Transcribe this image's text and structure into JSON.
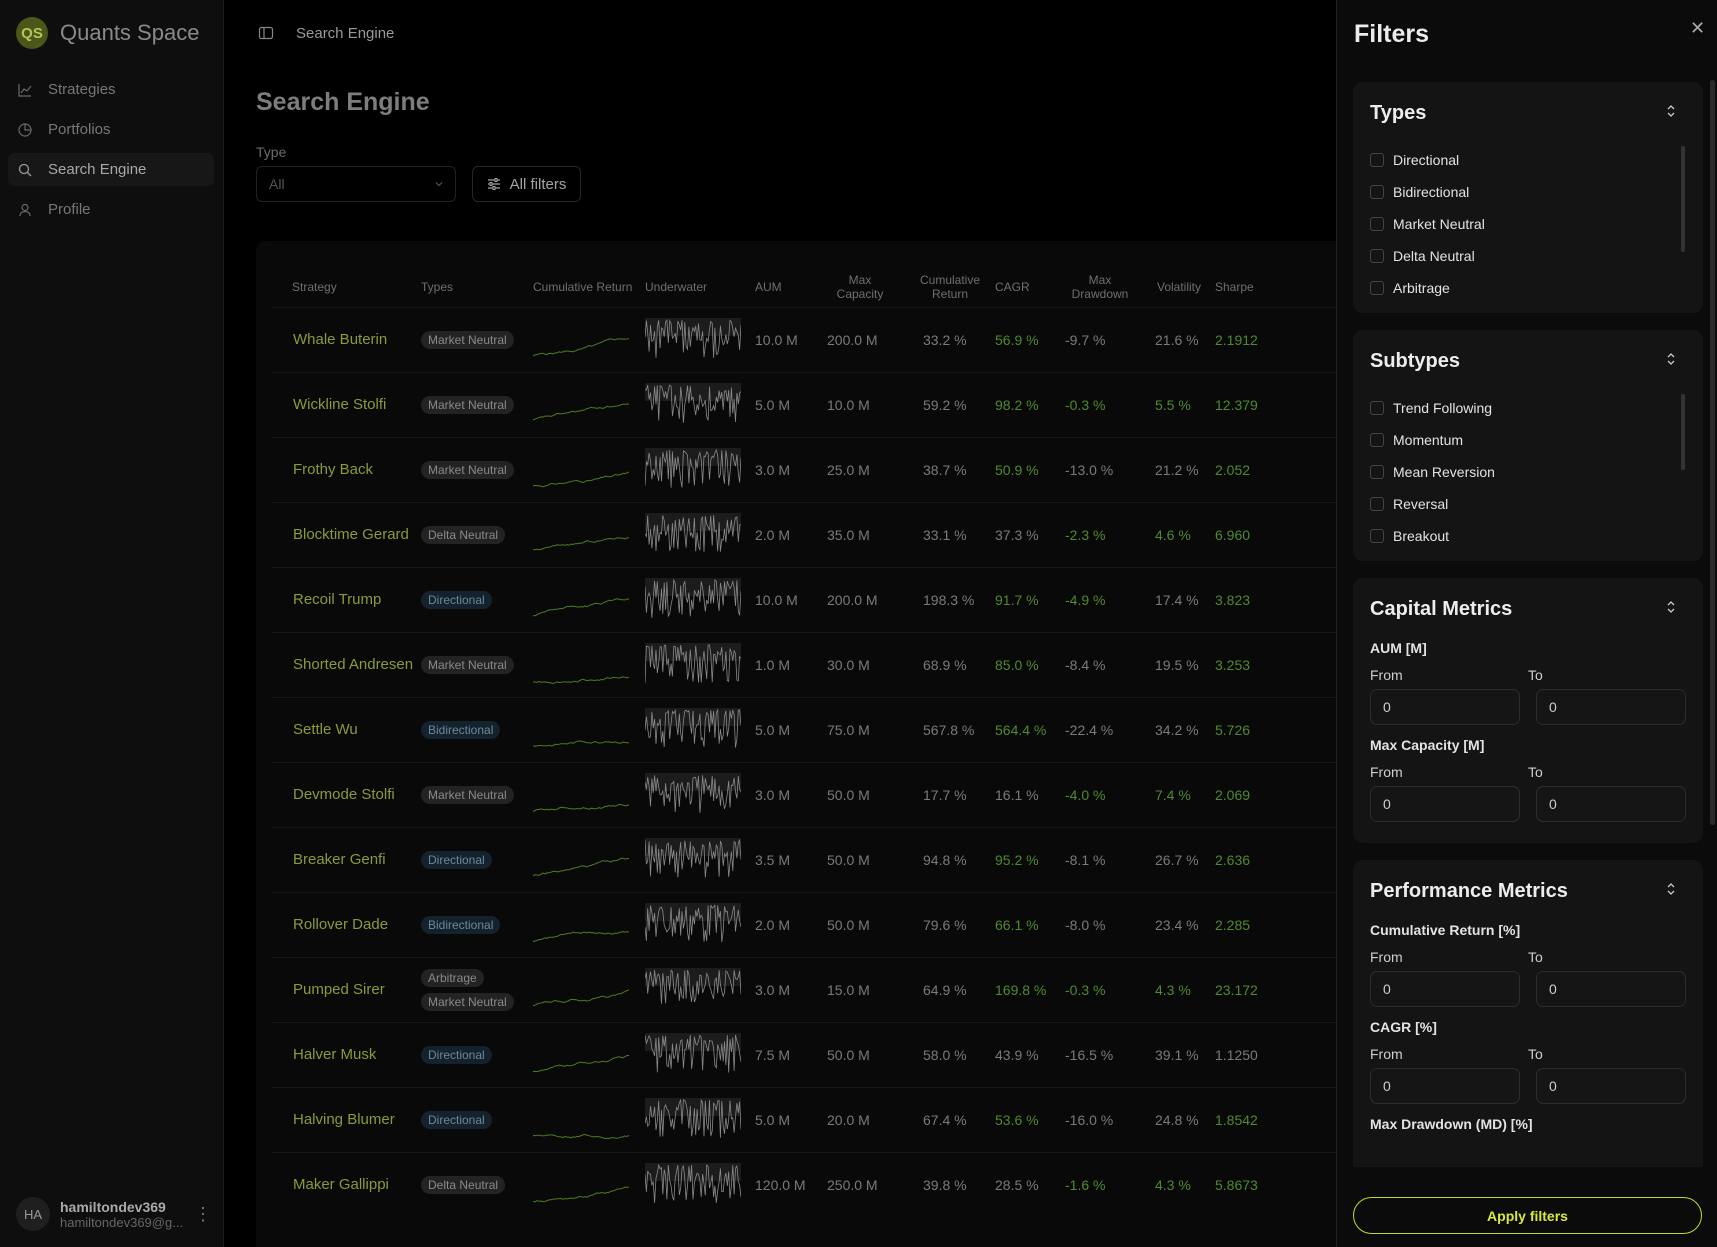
{
  "app": {
    "name": "Quants Space",
    "logo_text": "QS"
  },
  "sidebar": {
    "items": [
      {
        "label": "Strategies",
        "icon": "chart-line-icon"
      },
      {
        "label": "Portfolios",
        "icon": "pie-chart-icon"
      },
      {
        "label": "Search Engine",
        "icon": "search-icon",
        "active": true
      },
      {
        "label": "Profile",
        "icon": "user-icon"
      }
    ],
    "user": {
      "initials": "HA",
      "name": "hamiltondev369",
      "email": "hamiltondev369@g..."
    }
  },
  "header": {
    "breadcrumb": "Search Engine"
  },
  "main": {
    "title": "Search Engine",
    "type_label": "Type",
    "type_value": "All",
    "all_filters_label": "All filters"
  },
  "table": {
    "headers": {
      "strategy": "Strategy",
      "types": "Types",
      "cum_return_chart": "Cumulative Return",
      "underwater": "Underwater",
      "aum": "AUM",
      "max_capacity_1": "Max",
      "max_capacity_2": "Capacity",
      "cum_return_1": "Cumulative",
      "cum_return_2": "Return",
      "cagr": "CAGR",
      "max_dd_1": "Max",
      "max_dd_2": "Drawdown",
      "volatility": "Volatility",
      "sharpe": "Sharpe"
    },
    "rows": [
      {
        "name": "Whale Buterin",
        "types": [
          "Market Neutral"
        ],
        "aum": "10.0 M",
        "max_capacity": "200.0 M",
        "cum_return": "33.2 %",
        "cagr": "56.9 %",
        "max_dd": "-9.7 %",
        "volatility": "21.6 %",
        "sharpe": "2.1912",
        "cagr_green": true,
        "dd_green": false,
        "vol_green": false,
        "sharpe_green": true
      },
      {
        "name": "Wickline Stolfi",
        "types": [
          "Market Neutral"
        ],
        "aum": "5.0 M",
        "max_capacity": "10.0 M",
        "cum_return": "59.2 %",
        "cagr": "98.2 %",
        "max_dd": "-0.3 %",
        "volatility": "5.5 %",
        "sharpe": "12.379",
        "cagr_green": true,
        "dd_green": true,
        "vol_green": true,
        "sharpe_green": true
      },
      {
        "name": "Frothy Back",
        "types": [
          "Market Neutral"
        ],
        "aum": "3.0 M",
        "max_capacity": "25.0 M",
        "cum_return": "38.7 %",
        "cagr": "50.9 %",
        "max_dd": "-13.0 %",
        "volatility": "21.2 %",
        "sharpe": "2.052",
        "cagr_green": true,
        "dd_green": false,
        "vol_green": false,
        "sharpe_green": true
      },
      {
        "name": "Blocktime Gerard",
        "types": [
          "Delta Neutral"
        ],
        "aum": "2.0 M",
        "max_capacity": "35.0 M",
        "cum_return": "33.1 %",
        "cagr": "37.3 %",
        "max_dd": "-2.3 %",
        "volatility": "4.6 %",
        "sharpe": "6.960",
        "cagr_green": false,
        "dd_green": true,
        "vol_green": true,
        "sharpe_green": true
      },
      {
        "name": "Recoil Trump",
        "types": [
          "Directional"
        ],
        "aum": "10.0 M",
        "max_capacity": "200.0 M",
        "cum_return": "198.3 %",
        "cagr": "91.7 %",
        "max_dd": "-4.9 %",
        "volatility": "17.4 %",
        "sharpe": "3.823",
        "cagr_green": true,
        "dd_green": true,
        "vol_green": false,
        "sharpe_green": true
      },
      {
        "name": "Shorted Andresen",
        "types": [
          "Market Neutral"
        ],
        "aum": "1.0 M",
        "max_capacity": "30.0 M",
        "cum_return": "68.9 %",
        "cagr": "85.0 %",
        "max_dd": "-8.4 %",
        "volatility": "19.5 %",
        "sharpe": "3.253",
        "cagr_green": true,
        "dd_green": false,
        "vol_green": false,
        "sharpe_green": true
      },
      {
        "name": "Settle Wu",
        "types": [
          "Bidirectional"
        ],
        "aum": "5.0 M",
        "max_capacity": "75.0 M",
        "cum_return": "567.8 %",
        "cagr": "564.4 %",
        "max_dd": "-22.4 %",
        "volatility": "34.2 %",
        "sharpe": "5.726",
        "cagr_green": true,
        "dd_green": false,
        "vol_green": false,
        "sharpe_green": true
      },
      {
        "name": "Devmode Stolfi",
        "types": [
          "Market Neutral"
        ],
        "aum": "3.0 M",
        "max_capacity": "50.0 M",
        "cum_return": "17.7 %",
        "cagr": "16.1 %",
        "max_dd": "-4.0 %",
        "volatility": "7.4 %",
        "sharpe": "2.069",
        "cagr_green": false,
        "dd_green": true,
        "vol_green": true,
        "sharpe_green": true
      },
      {
        "name": "Breaker Genfi",
        "types": [
          "Directional"
        ],
        "aum": "3.5 M",
        "max_capacity": "50.0 M",
        "cum_return": "94.8 %",
        "cagr": "95.2 %",
        "max_dd": "-8.1 %",
        "volatility": "26.7 %",
        "sharpe": "2.636",
        "cagr_green": true,
        "dd_green": false,
        "vol_green": false,
        "sharpe_green": true
      },
      {
        "name": "Rollover Dade",
        "types": [
          "Bidirectional"
        ],
        "aum": "2.0 M",
        "max_capacity": "50.0 M",
        "cum_return": "79.6 %",
        "cagr": "66.1 %",
        "max_dd": "-8.0 %",
        "volatility": "23.4 %",
        "sharpe": "2.285",
        "cagr_green": true,
        "dd_green": false,
        "vol_green": false,
        "sharpe_green": true
      },
      {
        "name": "Pumped Sirer",
        "types": [
          "Arbitrage",
          "Market Neutral"
        ],
        "aum": "3.0 M",
        "max_capacity": "15.0 M",
        "cum_return": "64.9 %",
        "cagr": "169.8 %",
        "max_dd": "-0.3 %",
        "volatility": "4.3 %",
        "sharpe": "23.172",
        "cagr_green": true,
        "dd_green": true,
        "vol_green": true,
        "sharpe_green": true
      },
      {
        "name": "Halver Musk",
        "types": [
          "Directional"
        ],
        "aum": "7.5 M",
        "max_capacity": "50.0 M",
        "cum_return": "58.0 %",
        "cagr": "43.9 %",
        "max_dd": "-16.5 %",
        "volatility": "39.1 %",
        "sharpe": "1.1250",
        "cagr_green": false,
        "dd_green": false,
        "vol_green": false,
        "sharpe_green": false
      },
      {
        "name": "Halving Blumer",
        "types": [
          "Directional"
        ],
        "aum": "5.0 M",
        "max_capacity": "20.0 M",
        "cum_return": "67.4 %",
        "cagr": "53.6 %",
        "max_dd": "-16.0 %",
        "volatility": "24.8 %",
        "sharpe": "1.8542",
        "cagr_green": true,
        "dd_green": false,
        "vol_green": false,
        "sharpe_green": true
      },
      {
        "name": "Maker Gallippi",
        "types": [
          "Delta Neutral"
        ],
        "aum": "120.0 M",
        "max_capacity": "250.0 M",
        "cum_return": "39.8 %",
        "cagr": "28.5 %",
        "max_dd": "-1.6 %",
        "volatility": "4.3 %",
        "sharpe": "5.8673",
        "cagr_green": false,
        "dd_green": true,
        "vol_green": true,
        "sharpe_green": true
      }
    ]
  },
  "filters": {
    "title": "Filters",
    "types": {
      "title": "Types",
      "options": [
        "Directional",
        "Bidirectional",
        "Market Neutral",
        "Delta Neutral",
        "Arbitrage"
      ]
    },
    "subtypes": {
      "title": "Subtypes",
      "options": [
        "Trend Following",
        "Momentum",
        "Mean Reversion",
        "Reversal",
        "Breakout"
      ]
    },
    "capital": {
      "title": "Capital Metrics",
      "fields": [
        {
          "label": "AUM [M]",
          "from_label": "From",
          "to_label": "To",
          "from_value": "0",
          "to_value": "0"
        },
        {
          "label": "Max Capacity [M]",
          "from_label": "From",
          "to_label": "To",
          "from_value": "0",
          "to_value": "0"
        }
      ]
    },
    "performance": {
      "title": "Performance Metrics",
      "fields": [
        {
          "label": "Cumulative Return [%]",
          "from_label": "From",
          "to_label": "To",
          "from_value": "0",
          "to_value": "0"
        },
        {
          "label": "CAGR [%]",
          "from_label": "From",
          "to_label": "To",
          "from_value": "0",
          "to_value": "0"
        }
      ],
      "next_label": "Max Drawdown (MD) [%]"
    },
    "apply_label": "Apply filters"
  },
  "colors": {
    "accent": "#c3d82a",
    "positive": "#4f8a2e",
    "link": "#8a9a3a"
  }
}
